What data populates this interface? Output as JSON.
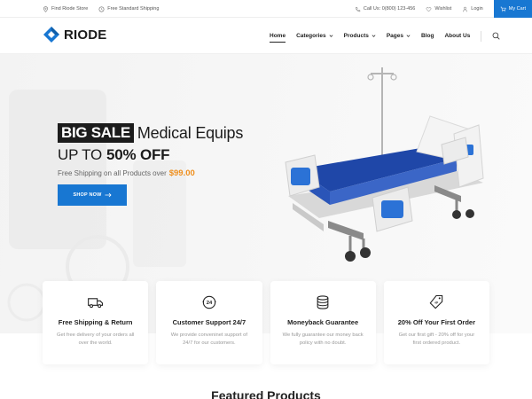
{
  "topbar": {
    "find_store": "Find Riode Store",
    "shipping": "Free Standard Shipping",
    "call": "Call Us: 0(800) 123-456",
    "wishlist": "Wishlist",
    "login": "Login",
    "cart": "My Cart"
  },
  "header": {
    "logo": "RIODE",
    "nav": [
      {
        "label": "Home"
      },
      {
        "label": "Categories"
      },
      {
        "label": "Products"
      },
      {
        "label": "Pages"
      },
      {
        "label": "Blog"
      },
      {
        "label": "About Us"
      }
    ]
  },
  "hero": {
    "badge": "BIG SALE",
    "title": "Medical Equips",
    "line2_prefix": "UP TO",
    "line2_big": "50% OFF",
    "line3_text": "Free Shipping on all Products over",
    "line3_price": "$99.00",
    "button": "SHOP NOW"
  },
  "features": [
    {
      "icon": "truck-icon",
      "title": "Free Shipping & Return",
      "desc": "Get free delivery of your orders all over the world."
    },
    {
      "icon": "support-24-icon",
      "title": "Customer Support 24/7",
      "desc": "We provide conveninet support of 24/7 for our customers."
    },
    {
      "icon": "coins-icon",
      "title": "Moneyback Guarantee",
      "desc": "We fully guarantee our money back policy with no doubt."
    },
    {
      "icon": "price-tag-icon",
      "title": "20% Off Your First Order",
      "desc": "Get our first gift - 20% off for your first ordered product."
    }
  ],
  "next_heading": "Featured Products",
  "colors": {
    "accent": "#1877d2",
    "price": "#ef8f1d",
    "dark": "#1c1c1c"
  }
}
